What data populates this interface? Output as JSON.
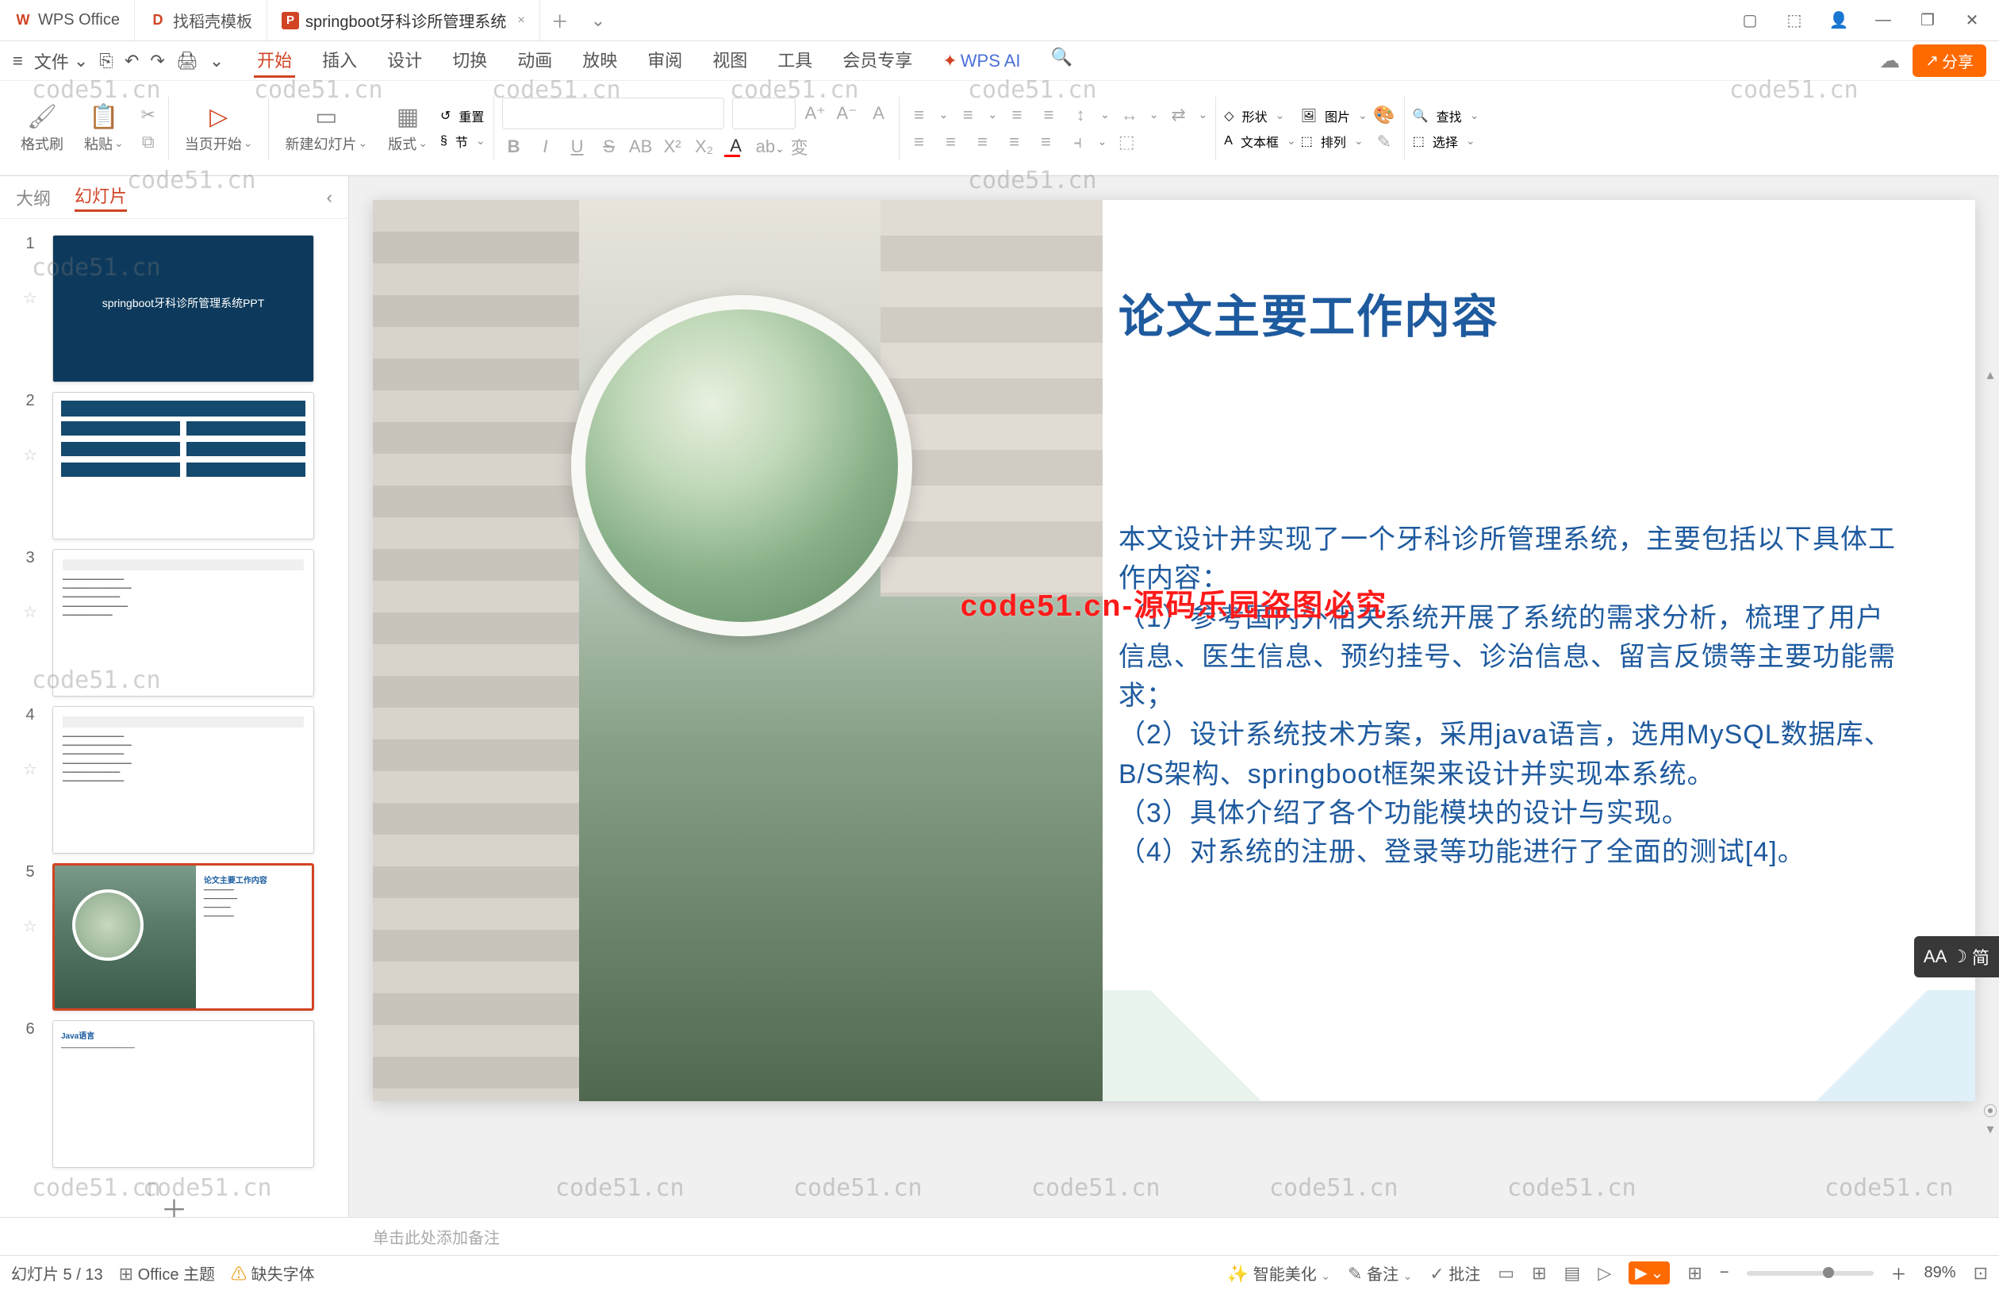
{
  "titlebar": {
    "tabs": [
      {
        "icon": "W",
        "icon_color": "#d14424",
        "label": "WPS Office"
      },
      {
        "icon": "D",
        "icon_color": "#d14424",
        "label": "找稻壳模板"
      },
      {
        "icon": "P",
        "icon_color": "#d14424",
        "label": "springboot牙科诊所管理系统",
        "close": "×"
      }
    ],
    "add": "＋",
    "dropdown": "⌄",
    "win": {
      "panel": "▢",
      "box": "⬚",
      "avatar": "👤",
      "min": "—",
      "max": "❐",
      "close": "✕"
    }
  },
  "menubar": {
    "hamburger": "≡",
    "file": "文件",
    "file_caret": "⌄",
    "quick": [
      "⎘",
      "↶",
      "↷",
      "🖨",
      "⌄"
    ],
    "tabs": [
      "开始",
      "插入",
      "设计",
      "切换",
      "动画",
      "放映",
      "审阅",
      "视图",
      "工具",
      "会员专享"
    ],
    "active_tab": "开始",
    "wps_ai": "WPS AI",
    "search_icon": "🔍",
    "cloud": "☁",
    "share_icon": "↗",
    "share": "分享"
  },
  "ribbon": {
    "format_painter": {
      "icon": "🖌",
      "label": "格式刷"
    },
    "paste": {
      "icon": "📋",
      "label": "粘贴"
    },
    "cut": "✂",
    "copy": "⧉",
    "fromcurrent": {
      "icon": "▷",
      "label": "当页开始"
    },
    "newslide": {
      "icon": "▭",
      "label": "新建幻灯片"
    },
    "layout": {
      "icon": "▦",
      "label": "版式"
    },
    "section": {
      "icon": "§",
      "label": "节"
    },
    "reset": {
      "icon": "↺",
      "label": "重置"
    },
    "font_placeholder": "",
    "size_placeholder": "",
    "bold": "B",
    "italic": "I",
    "underline": "U",
    "strike": "S",
    "ab": "AB",
    "x2": "X²",
    "x_": "X₂",
    "Aplus": "A⁺",
    "Aminus": "A⁻",
    "A3": "A",
    "Aa": "変",
    "para": [
      "≡",
      "≡",
      "≡",
      "≡",
      "≡",
      "≡",
      "≡",
      "↕",
      "↔",
      "⇄"
    ],
    "shape": {
      "icon": "◇",
      "label": "形状"
    },
    "text": {
      "icon": "A",
      "label": "文本框"
    },
    "pic": {
      "icon": "🖼",
      "label": "图片"
    },
    "arrange": {
      "icon": "⬚",
      "label": "排列"
    },
    "fill": "🎨",
    "find": {
      "icon": "🔍",
      "label": "查找"
    },
    "select": {
      "icon": "⬚",
      "label": "选择"
    }
  },
  "leftpanel": {
    "tab_outline": "大纲",
    "tab_slides": "幻灯片",
    "collapse": "‹",
    "thumbs": [
      {
        "n": "1",
        "title": "springboot牙科诊所管理系统PPT"
      },
      {
        "n": "2"
      },
      {
        "n": "3"
      },
      {
        "n": "4"
      },
      {
        "n": "5",
        "selected": true,
        "title": "论文主要工作内容"
      },
      {
        "n": "6"
      }
    ],
    "add": "＋"
  },
  "slide": {
    "title": "论文主要工作内容",
    "body_lines": [
      "本文设计并实现了一个牙科诊所管理系统，主要包括以下具体工作内容：",
      "（1）参考国内外相关系统开展了系统的需求分析，梳理了用户信息、医生信息、预约挂号、诊治信息、留言反馈等主要功能需求；",
      "（2）设计系统技术方案，采用java语言，选用MySQL数据库、B/S架构、springboot框架来设计并实现本系统。",
      "（3）具体介绍了各个功能模块的设计与实现。",
      "（4）对系统的注册、登录等功能进行了全面的测试[4]。"
    ],
    "watermark_red": "code51.cn-源码乐园盗图必究"
  },
  "notes": {
    "placeholder": "单击此处添加备注"
  },
  "statusbar": {
    "slide_count": "幻灯片 5 / 13",
    "theme_icon": "⊞",
    "theme": "Office 主题",
    "warn_icon": "⚠",
    "missing_font": "缺失字体",
    "beautify_icon": "✨",
    "beautify": "智能美化",
    "notes_icon": "✎",
    "notes": "备注",
    "notes_caret": "⌄",
    "review_icon": "✓",
    "review": "批注",
    "views": [
      "▭",
      "⊞",
      "▤",
      "▷"
    ],
    "play": "▶",
    "play_caret": "⌄",
    "grid": "⊞",
    "zoom_minus": "−",
    "zoom": "89%",
    "zoom_plus": "＋",
    "fit": "⊡"
  },
  "side_badge": {
    "aa": "AA",
    "moon": "☽",
    "jian": "简"
  },
  "watermark": "code51.cn"
}
